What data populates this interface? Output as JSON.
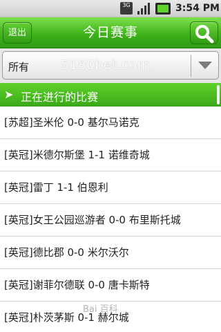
{
  "status_bar": {
    "network": "3G",
    "time": "3:54 PM",
    "icons": [
      "network-3g-icon",
      "signal-icon",
      "battery-icon"
    ]
  },
  "header": {
    "exit_label": "退出",
    "title": "今日赛事",
    "search_icon": "search-icon"
  },
  "filter": {
    "selected": "所有",
    "watermark": "5180bet.com",
    "dropdown_icon": "chevron-down-icon"
  },
  "section": {
    "label": "正在进行的比赛",
    "icon": "arrow-right-icon"
  },
  "matches": [
    "[苏超]圣米伦 0-0 基尔马诺克",
    "[英冠]米德尔斯堡 1-1 诺维奇城",
    "[英冠]雷丁 1-1 伯恩利",
    "[英冠]女王公园巡游者 0-0 布里斯托城",
    "[英冠]德比郡 0-0 米尔沃尔",
    "[英冠]谢菲尔德联 0-0 唐卡斯特",
    "[英冠]朴茨茅斯 0-1 赫尔城"
  ],
  "colors": {
    "accent_green": "#3fb21b",
    "section_green": "#4cbe22"
  },
  "watermark_bottom": "Bai 百科"
}
